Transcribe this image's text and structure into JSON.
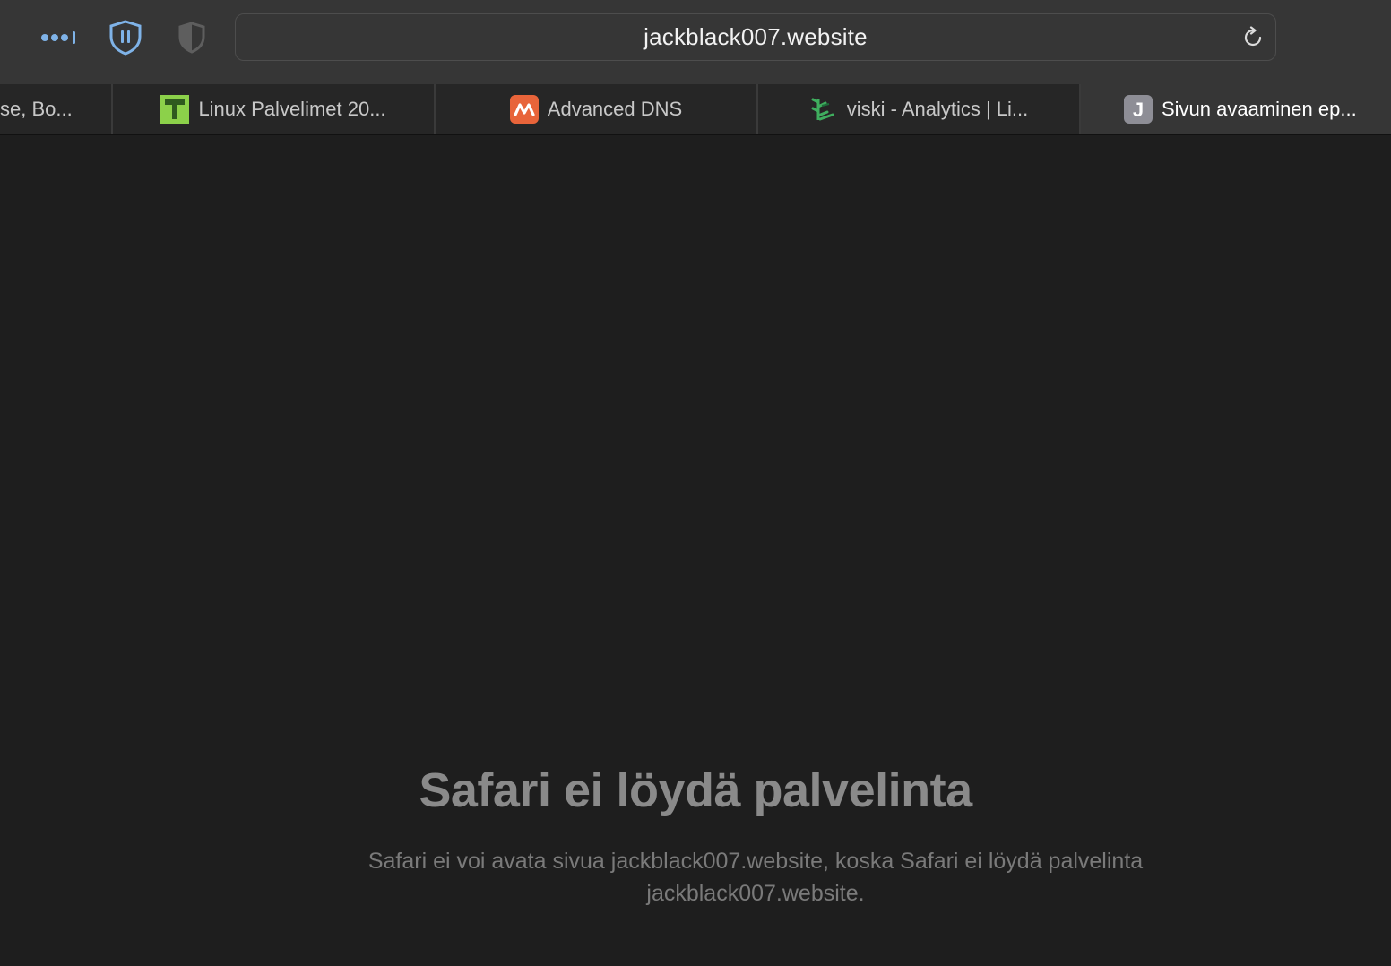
{
  "toolbar": {
    "address": "jackblack007.website",
    "extensions": [
      {
        "name": "1password-icon",
        "color": "#7fb3e8"
      },
      {
        "name": "bitwarden-icon",
        "color": "#7fb3e8"
      }
    ],
    "privacy_icon": "shield-icon",
    "reload_icon": "reload-icon"
  },
  "tabs": [
    {
      "label": "se, Bo...",
      "icon": null,
      "active": false
    },
    {
      "label": "Linux Palvelimet 20...",
      "icon": "T",
      "icon_bg": "#8cd14a",
      "active": false
    },
    {
      "label": "Advanced DNS",
      "icon": "namecheap-logo",
      "icon_bg": "#e8643a",
      "active": false
    },
    {
      "label": "viski - Analytics | Li...",
      "icon": "plant-icon",
      "active": false
    },
    {
      "label": "Sivun avaaminen ep...",
      "icon": "J",
      "icon_bg": "#8e8e96",
      "active": true
    }
  ],
  "error": {
    "title": "Safari ei löydä palvelinta",
    "description": "Safari ei voi avata sivua jackblack007.website, koska Safari ei löydä palvelinta jackblack007.website."
  }
}
